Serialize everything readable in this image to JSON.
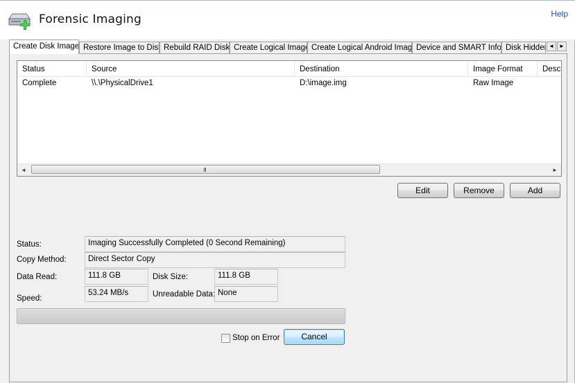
{
  "app": {
    "title": "Forensic Imaging",
    "help_label": "Help",
    "logo_icon": "drive-add-icon"
  },
  "tabs": [
    {
      "label": "Create Disk Image",
      "active": true
    },
    {
      "label": "Restore Image to Disk"
    },
    {
      "label": "Rebuild RAID Disk"
    },
    {
      "label": "Create Logical Image"
    },
    {
      "label": "Create Logical Android Image"
    },
    {
      "label": "Device and SMART Info"
    },
    {
      "label": "Disk Hidden"
    }
  ],
  "tab_scroll": {
    "left": "◄",
    "right": "►"
  },
  "list": {
    "columns": [
      "Status",
      "Source",
      "Destination",
      "Image Format",
      "Desc"
    ],
    "rows": [
      {
        "status": "Complete",
        "source": "\\\\.\\PhysicalDrive1",
        "destination": "D:\\image.img",
        "format": "Raw Image",
        "desc": ""
      }
    ],
    "scroll": {
      "left": "◄",
      "right": "►",
      "grip": "III"
    }
  },
  "list_buttons": {
    "edit": "Edit",
    "remove": "Remove",
    "add": "Add"
  },
  "details": {
    "status_label": "Status:",
    "status_value": "Imaging Successfully Completed (0 Second Remaining)",
    "copy_method_label": "Copy Method:",
    "copy_method_value": "Direct Sector Copy",
    "data_read_label": "Data Read:",
    "data_read_value": "111.8 GB",
    "disk_size_label": "Disk Size:",
    "disk_size_value": "111.8 GB",
    "speed_label": "Speed:",
    "speed_value": "53.24 MB/s",
    "unreadable_label": "Unreadable Data:",
    "unreadable_value": "None"
  },
  "progress": {
    "percent": 100
  },
  "footer": {
    "stop_on_error_label": "Stop on Error",
    "stop_on_error_checked": false,
    "cancel_label": "Cancel"
  }
}
